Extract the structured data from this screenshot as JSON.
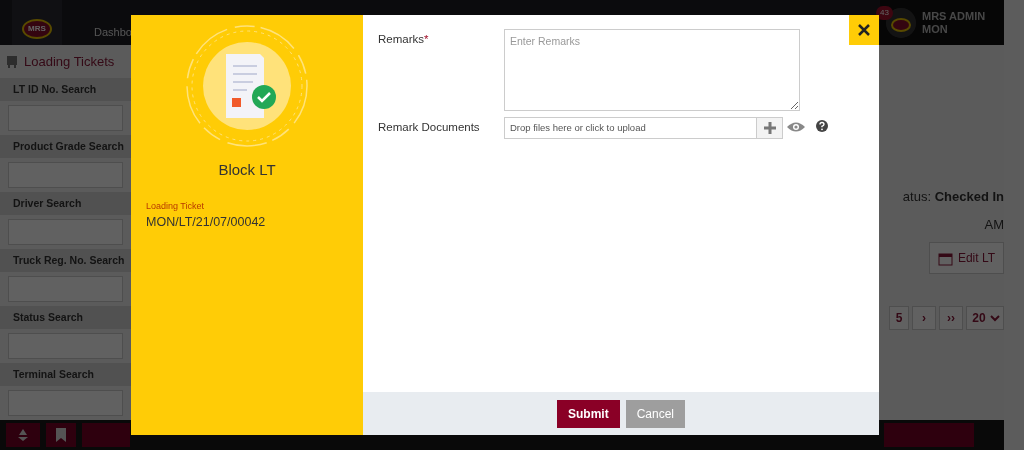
{
  "app": {
    "logo_text": "MRS",
    "nav": [
      {
        "label": "Dashbo"
      }
    ],
    "notification_count": "43",
    "user": {
      "name": "MRS ADMIN",
      "terminal": "MON"
    }
  },
  "sidebar": {
    "title": "Loading Tickets",
    "filters": [
      {
        "label": "LT ID No. Search"
      },
      {
        "label": "Product Grade Search"
      },
      {
        "label": "Driver Search"
      },
      {
        "label": "Truck Reg. No. Search"
      },
      {
        "label": "Status Search"
      },
      {
        "label": "Terminal Search"
      }
    ]
  },
  "content": {
    "status_label": "atus:",
    "status_value": "Checked In",
    "time_fragment": "AM",
    "edit_button": "Edit LT",
    "pagination": [
      "5",
      "›",
      "››"
    ],
    "page_size": "20"
  },
  "modal": {
    "title": "Block LT",
    "ticket_label": "Loading Ticket",
    "ticket_value": "MON/LT/21/07/00042",
    "fields": [
      {
        "kind": "textarea",
        "label": "Remarks",
        "required_mark": "*",
        "placeholder": "Enter Remarks"
      },
      {
        "kind": "upload",
        "label": "Remark Documents",
        "placeholder": "Drop files here or click to upload"
      }
    ],
    "buttons": [
      {
        "kind": "primary",
        "label": "Submit"
      },
      {
        "kind": "secondary",
        "label": "Cancel"
      }
    ]
  }
}
